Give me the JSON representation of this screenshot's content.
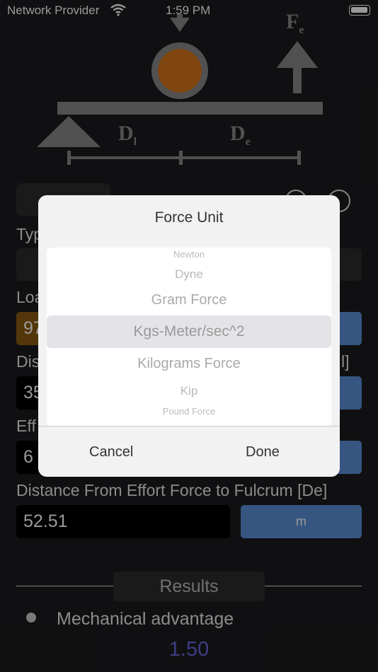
{
  "status": {
    "carrier": "Network Provider",
    "time": "1:59 PM"
  },
  "diagram": {
    "force_label": "F",
    "force_sub": "e",
    "dl": "D",
    "dl_sub": "l",
    "de": "D",
    "de_sub": "e"
  },
  "form": {
    "type_label": "Typ",
    "load_label": "Loa",
    "load_value": "97",
    "dist_label": "Dis",
    "dist_suffix": "l]",
    "dist_value": "35",
    "effort_label": "Eff",
    "effort_value": "6",
    "de_label": "Distance From Effort Force to Fulcrum [De]",
    "de_value": "52.51",
    "de_unit": "m"
  },
  "dialog": {
    "title": "Force Unit",
    "options": [
      "Newton",
      "Dyne",
      "Gram Force",
      "Kgs-Meter/sec^2",
      "Kilograms Force",
      "Kip",
      "Pound Force"
    ],
    "selected": "Kgs-Meter/sec^2",
    "cancel": "Cancel",
    "done": "Done"
  },
  "results": {
    "header": "Results",
    "item_label": "Mechanical advantage",
    "item_value": "1.50"
  },
  "colors": {
    "accent": "#5b8ed6",
    "ball": "#d2731a",
    "result": "#6a64e0"
  }
}
